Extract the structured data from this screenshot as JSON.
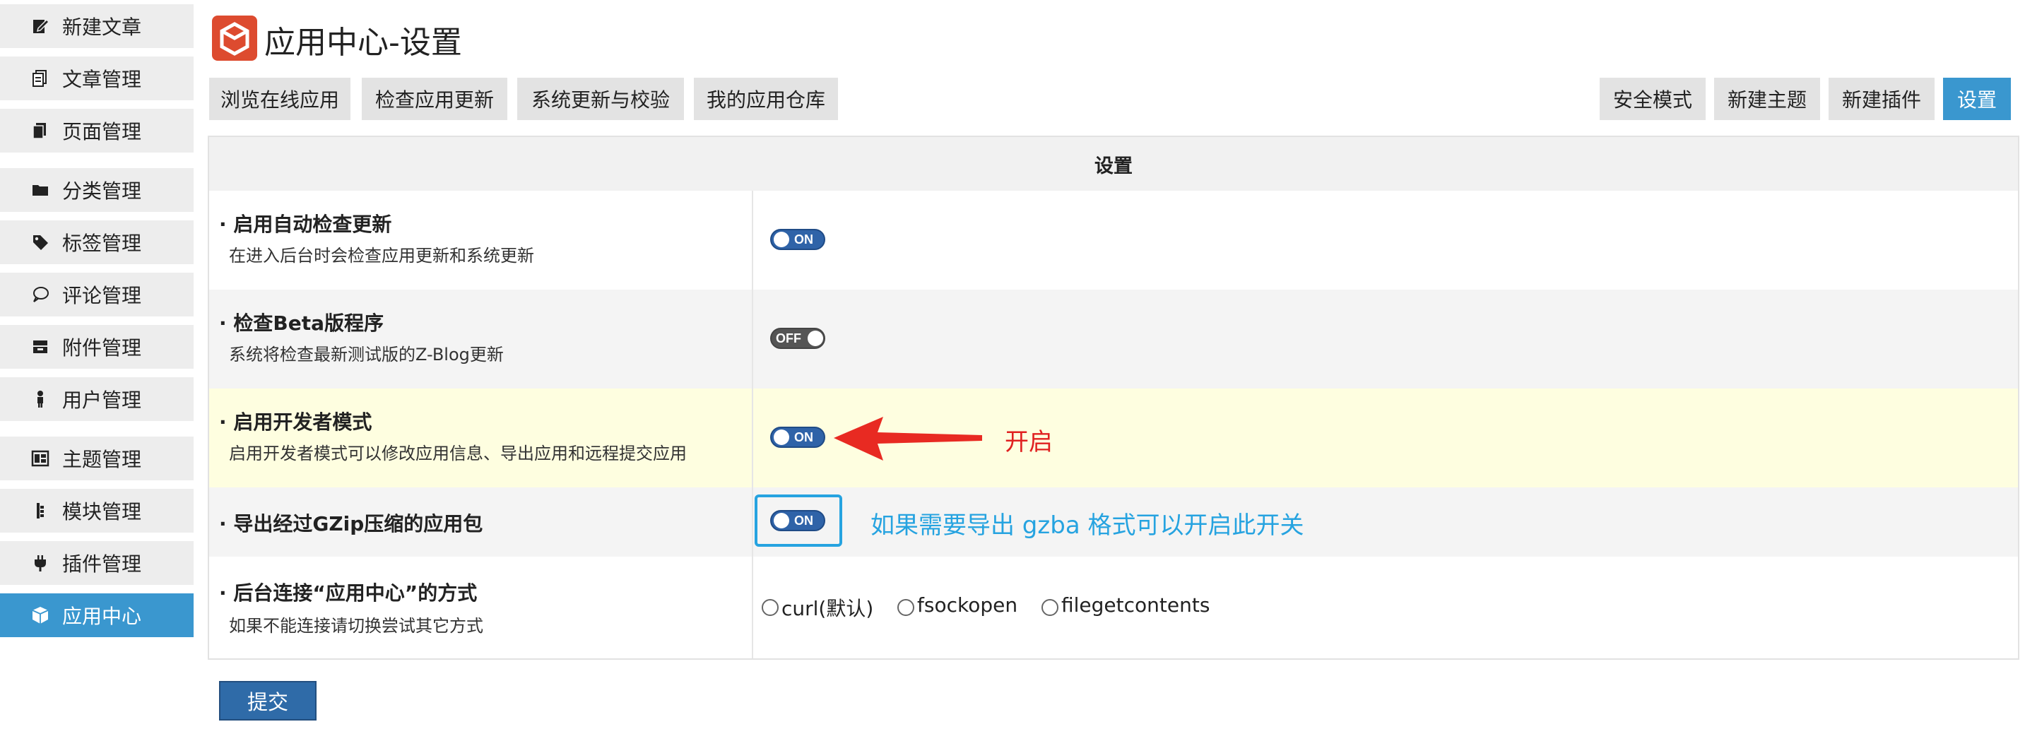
{
  "sidebar": {
    "items": [
      {
        "label": "新建文章",
        "icon": "edit-icon"
      },
      {
        "label": "文章管理",
        "icon": "documents-icon"
      },
      {
        "label": "页面管理",
        "icon": "pages-icon"
      },
      {
        "label": "分类管理",
        "icon": "folder-icon"
      },
      {
        "label": "标签管理",
        "icon": "tag-icon"
      },
      {
        "label": "评论管理",
        "icon": "comment-icon"
      },
      {
        "label": "附件管理",
        "icon": "attachment-icon"
      },
      {
        "label": "用户管理",
        "icon": "user-icon"
      },
      {
        "label": "主题管理",
        "icon": "theme-icon"
      },
      {
        "label": "模块管理",
        "icon": "module-icon"
      },
      {
        "label": "插件管理",
        "icon": "plugin-icon"
      },
      {
        "label": "应用中心",
        "icon": "cube-icon",
        "active": true
      }
    ]
  },
  "header": {
    "title": "应用中心-设置",
    "logo_icon": "app-center-logo-icon"
  },
  "tabs_left": [
    "浏览在线应用",
    "检查应用更新",
    "系统更新与校验",
    "我的应用仓库"
  ],
  "tabs_right": [
    "安全模式",
    "新建主题",
    "新建插件",
    "设置"
  ],
  "table": {
    "header": "设置",
    "rows": [
      {
        "title": "· 启用自动检查更新",
        "desc": "在进入后台时会检查应用更新和系统更新",
        "toggle": "ON"
      },
      {
        "title": "· 检查Beta版程序",
        "desc": "系统将检查最新测试版的Z-Blog更新",
        "toggle": "OFF"
      },
      {
        "title": "· 启用开发者模式",
        "desc": "启用开发者模式可以修改应用信息、导出应用和远程提交应用",
        "toggle": "ON"
      },
      {
        "title": "· 导出经过GZip压缩的应用包",
        "desc": "",
        "toggle": "ON"
      },
      {
        "title": "· 后台连接“应用中心”的方式",
        "desc": "如果不能连接请切换尝试其它方式"
      }
    ],
    "radio_options": [
      "curl(默认)",
      "fsockopen",
      "filegetcontents"
    ]
  },
  "submit_label": "提交",
  "annotations": {
    "dev_mode": "开启",
    "gzip": "如果需要导出 gzba 格式可以开启此开关"
  },
  "colors": {
    "accent": "#3a97cf",
    "toggle_on": "#2f63a8",
    "highlight_row": "#fefee0",
    "annotation_red": "#e02020",
    "annotation_blue": "#26a3e0"
  }
}
